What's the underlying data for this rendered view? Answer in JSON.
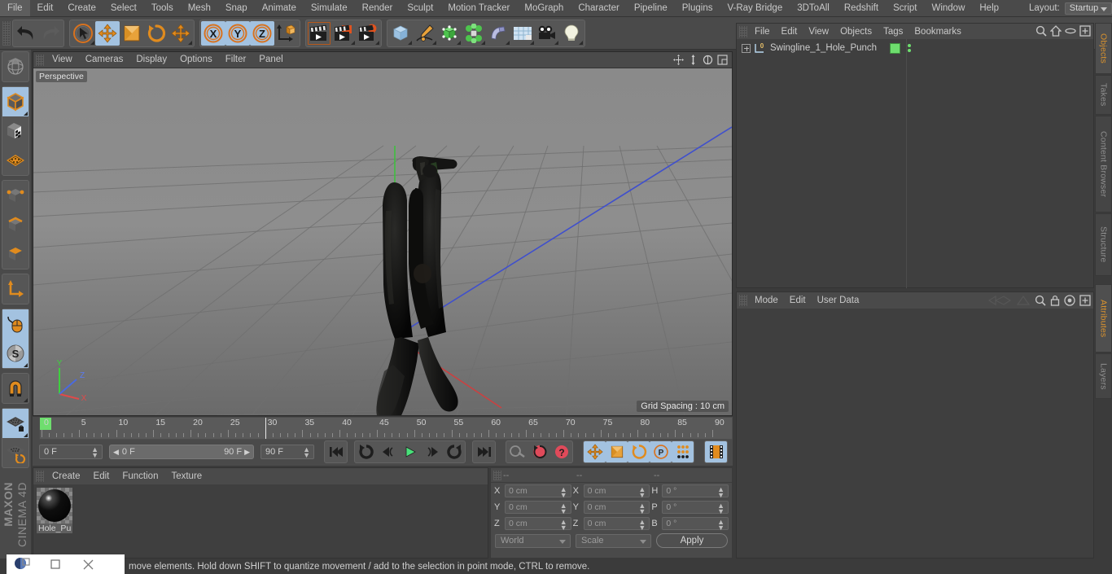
{
  "menubar": {
    "items": [
      "File",
      "Edit",
      "Create",
      "Select",
      "Tools",
      "Mesh",
      "Snap",
      "Animate",
      "Simulate",
      "Render",
      "Sculpt",
      "Motion Tracker",
      "MoGraph",
      "Character",
      "Pipeline",
      "Plugins",
      "V-Ray Bridge",
      "3DToAll",
      "Redshift",
      "Script",
      "Window",
      "Help"
    ],
    "layout_label": "Layout:",
    "layout_value": "Startup",
    "search_icon": "search-icon"
  },
  "toolbar": {
    "groups": [
      {
        "name": "undo-redo",
        "buttons": [
          {
            "name": "undo-button",
            "icon": "undo-arrow-icon",
            "state": "normal"
          },
          {
            "name": "redo-button",
            "icon": "redo-arrow-icon",
            "state": "disabled"
          }
        ]
      },
      {
        "name": "transform-tools",
        "buttons": [
          {
            "name": "live-selection-button",
            "icon": "cursor-circle-icon",
            "state": "normal"
          },
          {
            "name": "move-button",
            "icon": "move-arrows-icon",
            "state": "selected"
          },
          {
            "name": "scale-button",
            "icon": "scale-box-icon",
            "state": "normal"
          },
          {
            "name": "rotate-button",
            "icon": "rotate-circle-icon",
            "state": "normal"
          },
          {
            "name": "move-dup-button",
            "icon": "move-arrows-icon",
            "state": "normal"
          }
        ]
      },
      {
        "name": "axis-locks",
        "buttons": [
          {
            "name": "x-axis-button",
            "icon": "x-axis-icon",
            "state": "selected"
          },
          {
            "name": "y-axis-button",
            "icon": "y-axis-icon",
            "state": "selected"
          },
          {
            "name": "z-axis-button",
            "icon": "z-axis-icon",
            "state": "selected"
          },
          {
            "name": "world-object-axis-button",
            "icon": "world-axis-cube-icon",
            "state": "normal"
          }
        ]
      },
      {
        "name": "render-tools",
        "buttons": [
          {
            "name": "render-view-button",
            "icon": "clapperboard-icon",
            "state": "normal"
          },
          {
            "name": "render-to-picture-viewer-button",
            "icon": "clapperboard-orange-icon",
            "state": "normal"
          },
          {
            "name": "render-settings-button",
            "icon": "clapperboard-gear-icon",
            "state": "normal"
          }
        ]
      },
      {
        "name": "object-tools",
        "buttons": [
          {
            "name": "cube-primitive-button",
            "icon": "cube-blue-icon",
            "state": "normal"
          },
          {
            "name": "spline-pen-button",
            "icon": "pen-spline-icon",
            "state": "normal"
          },
          {
            "name": "generators-button",
            "icon": "green-cube-icon",
            "state": "normal"
          },
          {
            "name": "mograph-button",
            "icon": "green-cluster-icon",
            "state": "normal"
          },
          {
            "name": "deformers-button",
            "icon": "bend-deformer-icon",
            "state": "normal"
          },
          {
            "name": "scene-floor-button",
            "icon": "grid-floor-icon",
            "state": "normal"
          },
          {
            "name": "camera-button",
            "icon": "camera-icon",
            "state": "normal"
          },
          {
            "name": "light-button",
            "icon": "lightbulb-icon",
            "state": "normal"
          }
        ]
      }
    ]
  },
  "leftbar": {
    "buttons": [
      {
        "name": "undo-view-button",
        "icon": "globe-sphere-icon",
        "state": "normal"
      },
      {
        "name": "model-mode-button",
        "icon": "cube-orange-outline-icon",
        "state": "selected"
      },
      {
        "name": "texture-mode-button",
        "icon": "checker-cube-icon",
        "state": "normal"
      },
      {
        "name": "polygon-mode-button",
        "icon": "orange-grid-plane-icon",
        "state": "normal"
      },
      {
        "name": "points-mode-button",
        "icon": "cube-points-icon",
        "state": "normal"
      },
      {
        "name": "edges-mode-button",
        "icon": "cube-edges-icon",
        "state": "normal"
      },
      {
        "name": "polygons-mode-button",
        "icon": "cube-face-icon",
        "state": "normal"
      },
      {
        "name": "axis-modify-button",
        "icon": "axis-corner-icon",
        "state": "normal"
      },
      {
        "name": "enable-axis-button",
        "icon": "mouse-pointer-icon",
        "state": "selected"
      },
      {
        "name": "soft-selection-button",
        "icon": "s-circle-icon",
        "state": "selected"
      },
      {
        "name": "snap-magnet-button",
        "icon": "magnet-icon",
        "state": "normal"
      },
      {
        "name": "workplane-lock-button",
        "icon": "grid-lock-icon",
        "state": "selected"
      },
      {
        "name": "workplane-rotate-button",
        "icon": "grid-rotate-icon",
        "state": "normal"
      }
    ]
  },
  "viewport": {
    "menu": [
      "View",
      "Cameras",
      "Display",
      "Options",
      "Filter",
      "Panel"
    ],
    "label": "Perspective",
    "grid_spacing": "Grid Spacing : 10 cm",
    "nav_icons": [
      "pan-icon",
      "dolly-icon",
      "rotate-icon",
      "maximize-icon"
    ],
    "axis": {
      "x": "X",
      "y": "Y",
      "z": "Z",
      "x_color": "#e04a4a",
      "y_color": "#44d044",
      "z_color": "#4a6ae0"
    },
    "object_color": "#161616"
  },
  "timeline": {
    "ticks": [
      0,
      5,
      10,
      15,
      20,
      25,
      30,
      35,
      40,
      45,
      50,
      55,
      60,
      65,
      70,
      75,
      80,
      85,
      90
    ],
    "current_frame": "0 F",
    "range_start": "0 F",
    "range_end": "90 F",
    "end_frame": "90 F",
    "playhead_frame": 0,
    "controls": [
      {
        "name": "go-to-start-button",
        "icon": "skip-start-icon"
      },
      {
        "name": "previous-key-button",
        "icon": "prev-key-icon"
      },
      {
        "name": "step-back-button",
        "icon": "step-back-icon"
      },
      {
        "name": "play-button",
        "icon": "play-icon"
      },
      {
        "name": "step-forward-button",
        "icon": "step-forward-icon"
      },
      {
        "name": "next-key-button",
        "icon": "next-key-icon"
      },
      {
        "name": "go-to-end-button",
        "icon": "skip-end-icon"
      },
      {
        "name": "record-active-objects-button",
        "icon": "key-icon"
      },
      {
        "name": "autokeying-button",
        "icon": "record-circle-icon"
      },
      {
        "name": "keyframe-selection-button",
        "icon": "question-circle-icon"
      },
      {
        "name": "position-key-button",
        "icon": "move-arrows-icon"
      },
      {
        "name": "scale-key-button",
        "icon": "scale-box-icon"
      },
      {
        "name": "rotation-key-button",
        "icon": "rotate-circle-icon"
      },
      {
        "name": "param-key-button",
        "icon": "p-circle-icon"
      },
      {
        "name": "point-level-anim-button",
        "icon": "dots-grid-icon"
      },
      {
        "name": "timeline-toggle-button",
        "icon": "filmstrip-icon"
      }
    ]
  },
  "material_manager": {
    "menu": [
      "Create",
      "Edit",
      "Function",
      "Texture"
    ],
    "materials": [
      {
        "name": "Hole_Pu",
        "color": "#0a0a0a"
      }
    ]
  },
  "coordinate_manager": {
    "header_cols": [
      "--",
      "--",
      "--"
    ],
    "rows": [
      {
        "pos_label": "X",
        "pos_value": "0 cm",
        "size_label": "X",
        "size_value": "0 cm",
        "rot_label": "H",
        "rot_value": "0 °"
      },
      {
        "pos_label": "Y",
        "pos_value": "0 cm",
        "size_label": "Y",
        "size_value": "0 cm",
        "rot_label": "P",
        "rot_value": "0 °"
      },
      {
        "pos_label": "Z",
        "pos_value": "0 cm",
        "size_label": "Z",
        "size_value": "0 cm",
        "rot_label": "B",
        "rot_value": "0 °"
      }
    ],
    "coord_system": "World",
    "transform_mode": "Scale",
    "apply_label": "Apply"
  },
  "object_manager": {
    "menu": [
      "File",
      "Edit",
      "View",
      "Objects",
      "Tags",
      "Bookmarks"
    ],
    "header_icons": [
      "search-icon",
      "home-icon",
      "ellipse-icon",
      "plus-box-icon"
    ],
    "objects": [
      {
        "name": "Swingline_1_Hole_Punch",
        "layer": "0",
        "tag_color": "#6ede6e"
      }
    ]
  },
  "attribute_manager": {
    "menu": [
      "Mode",
      "Edit",
      "User Data"
    ],
    "header_icons": [
      "back-nav-icon",
      "forward-nav-icon",
      "search-icon",
      "lock-icon",
      "target-icon",
      "plus-box-icon"
    ]
  },
  "right_tabs": {
    "top": [
      {
        "label": "Objects",
        "active": true
      },
      {
        "label": "Takes",
        "active": false
      },
      {
        "label": "Content Browser",
        "active": false
      },
      {
        "label": "Structure",
        "active": false
      }
    ],
    "bottom": [
      {
        "label": "Attributes",
        "active": true
      },
      {
        "label": "Layers",
        "active": false
      }
    ]
  },
  "statusbar": {
    "text": "move elements. Hold down SHIFT to quantize movement / add to the selection in point mode, CTRL to remove."
  },
  "branding": {
    "line1": "MAXON",
    "line2": "CINEMA 4D"
  }
}
